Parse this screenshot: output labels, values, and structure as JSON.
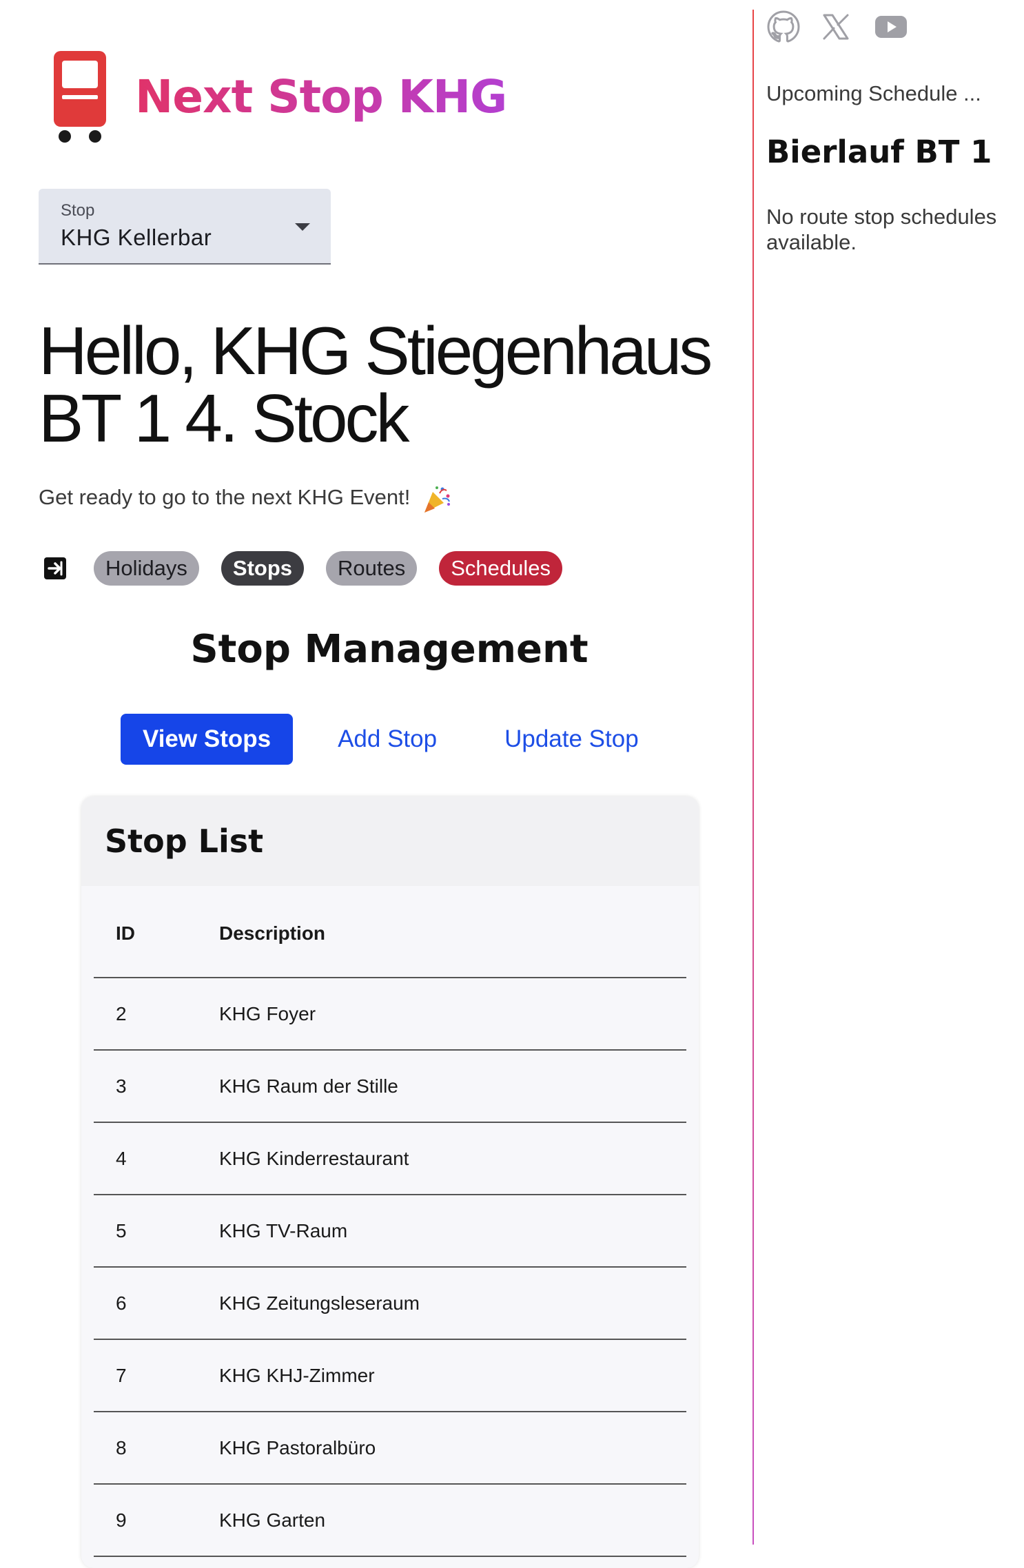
{
  "app": {
    "title": "Next Stop KHG",
    "logo_icon": "bus-icon"
  },
  "stop_select": {
    "label": "Stop",
    "value": "KHG Kellerbar"
  },
  "greeting": "Hello, KHG Stiegenhaus BT 1 4. Stock",
  "subtitle": "Get ready to go to the next KHG Event!",
  "subtitle_icon": "party-popper-icon",
  "nav": {
    "logout_icon": "logout-icon",
    "pills": [
      {
        "label": "Holidays",
        "color": "#a6a5ad"
      },
      {
        "label": "Stops",
        "color": "#3c3c41"
      },
      {
        "label": "Routes",
        "color": "#a6a5ad"
      },
      {
        "label": "Schedules",
        "color": "#c0253a"
      }
    ]
  },
  "section": {
    "title": "Stop Management",
    "tabs": [
      {
        "label": "View Stops",
        "active": true
      },
      {
        "label": "Add Stop",
        "active": false
      },
      {
        "label": "Update Stop",
        "active": false
      }
    ]
  },
  "stop_list": {
    "title": "Stop List",
    "columns": [
      "ID",
      "Description"
    ],
    "rows": [
      {
        "id": "2",
        "description": "KHG Foyer"
      },
      {
        "id": "3",
        "description": "KHG Raum der Stille"
      },
      {
        "id": "4",
        "description": "KHG Kinderrestaurant"
      },
      {
        "id": "5",
        "description": "KHG TV-Raum"
      },
      {
        "id": "6",
        "description": "KHG Zeitungsleseraum"
      },
      {
        "id": "7",
        "description": "KHG KHJ-Zimmer"
      },
      {
        "id": "8",
        "description": "KHG Pastoralbüro"
      },
      {
        "id": "9",
        "description": "KHG Garten"
      }
    ]
  },
  "sidebar": {
    "social_icons": [
      "github-icon",
      "x-icon",
      "youtube-icon"
    ],
    "upcoming_label": "Upcoming Schedule ...",
    "schedule_name": "Bierlauf BT 1",
    "empty_message": "No route stop schedules available."
  },
  "colors": {
    "accent_blue": "#1645e8",
    "schedules_red": "#c0253a",
    "title_gradient_start": "#e0336a",
    "title_gradient_end": "#b33fd0"
  }
}
